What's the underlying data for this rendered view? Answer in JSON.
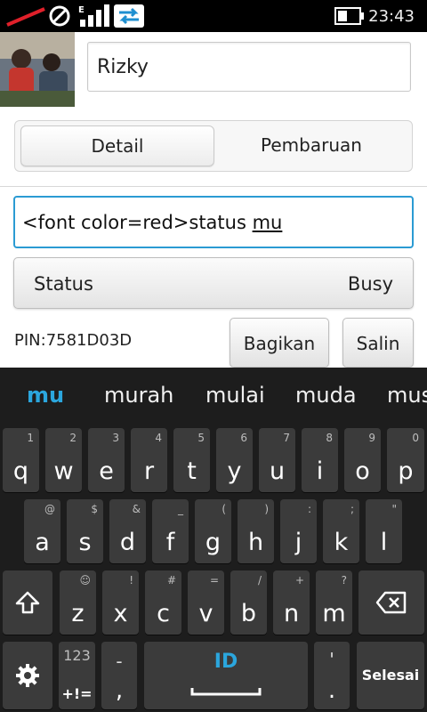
{
  "status_bar": {
    "time": "23:43"
  },
  "profile": {
    "name": "Rizky"
  },
  "tabs": [
    {
      "label": "Detail",
      "active": true
    },
    {
      "label": "Pembaruan",
      "active": false
    }
  ],
  "status_input": {
    "text_prefix": "<font color=red>status ",
    "text_composing": "mu"
  },
  "status_select": {
    "label": "Status",
    "value": "Busy"
  },
  "pin": "PIN:7581D03D",
  "buttons": {
    "share": "Bagikan",
    "copy": "Salin"
  },
  "keyboard": {
    "accent_color": "#2ba6dd",
    "suggestions": [
      "mu",
      "murah",
      "mulai",
      "muda",
      "mus"
    ],
    "rows": [
      [
        {
          "k": "q",
          "s": "1"
        },
        {
          "k": "w",
          "s": "2"
        },
        {
          "k": "e",
          "s": "3"
        },
        {
          "k": "r",
          "s": "4"
        },
        {
          "k": "t",
          "s": "5"
        },
        {
          "k": "y",
          "s": "6"
        },
        {
          "k": "u",
          "s": "7"
        },
        {
          "k": "i",
          "s": "8"
        },
        {
          "k": "o",
          "s": "9"
        },
        {
          "k": "p",
          "s": "0"
        }
      ],
      [
        {
          "k": "a",
          "s": "@"
        },
        {
          "k": "s",
          "s": "$"
        },
        {
          "k": "d",
          "s": "&"
        },
        {
          "k": "f",
          "s": "_"
        },
        {
          "k": "g",
          "s": "("
        },
        {
          "k": "h",
          "s": ")"
        },
        {
          "k": "j",
          "s": ":"
        },
        {
          "k": "k",
          "s": ";"
        },
        {
          "k": "l",
          "s": "\""
        }
      ],
      [
        {
          "k": "z",
          "s": "☺"
        },
        {
          "k": "x",
          "s": "!"
        },
        {
          "k": "c",
          "s": "#"
        },
        {
          "k": "v",
          "s": "="
        },
        {
          "k": "b",
          "s": "/"
        },
        {
          "k": "n",
          "s": "+"
        },
        {
          "k": "m",
          "s": "?"
        }
      ]
    ],
    "bottom": {
      "symbols_top": "123",
      "symbols_bottom": "+!=",
      "dash_key": "-",
      "comma_key": ",",
      "space_label": "ID",
      "apostrophe_key": "'",
      "period_key": ".",
      "done_label": "Selesai"
    },
    "icons": [
      "shift-icon",
      "backspace-icon",
      "settings-gear-icon",
      "space-bar-icon"
    ]
  }
}
